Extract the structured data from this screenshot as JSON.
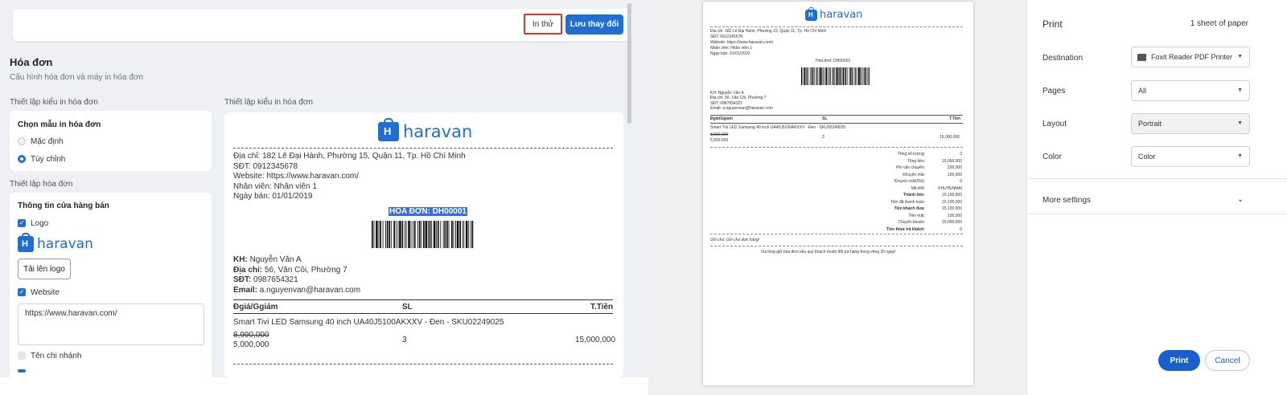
{
  "toolbar": {
    "test_print": "In thử",
    "save_changes": "Lưu thay đổi"
  },
  "page": {
    "title": "Hóa đơn",
    "subtitle": "Cấu hình hóa đơn và máy in hóa đơn"
  },
  "left_col": {
    "section_style": "Thiết lập kiểu in hóa đơn",
    "template_title": "Chọn mẫu in hóa đơn",
    "template_default": "Mặc định",
    "template_custom": "Tùy chỉnh",
    "section_invoice": "Thiết lập hóa đơn",
    "store_info_title": "Thông tin cửa hàng bán",
    "logo_label": "Logo",
    "upload_logo": "Tải lên logo",
    "website_label": "Website",
    "website_value": "https://www.haravan.com/",
    "branch_label": "Tên chi nhánh"
  },
  "preview_title": "Thiết lập kiểu in hóa đơn",
  "logo_text": "haravan",
  "invoice": {
    "address": "Địa chỉ: 182 Lê Đại Hành, Phường 15, Quận 11, Tp. Hồ Chí Minh",
    "phone": "SĐT: 0912345678",
    "website": "Website: https://www.haravan.com/",
    "staff": "Nhân viên: Nhân viên 1",
    "date": "Ngày bán: 01/01/2019",
    "invoice_no": "HÓA ĐƠN: DH00001",
    "customer_label": "KH:",
    "customer": "Nguyễn Văn A",
    "cust_addr_label": "Địa chỉ:",
    "cust_addr": "56, Văn Côi, Phường 7",
    "cust_phone_label": "SĐT:",
    "cust_phone": "0987654321",
    "cust_email_label": "Email:",
    "cust_email": "a.nguyenvan@haravan.com",
    "col_price": "Đgiá/Ggiảm",
    "col_qty": "SL",
    "col_total": "T.Tiền",
    "item_name": "Smart Tivi LED Samsung 40 inch UA40J5100AKXXV - Đen - SKU02249025",
    "item_old_price": "8,990,000",
    "item_price": "5,000,000",
    "item_qty": "3",
    "item_total": "15,000,000"
  },
  "print_preview": {
    "address": "Địa chỉ: 182 Lê Đại Hành, Phường 15, Quận 11, Tp. Hồ Chí Minh",
    "phone": "SĐT: 0912345678",
    "website": "Website: https://www.haravan.com/",
    "staff": "Nhân viên: Nhân viên 1",
    "date": "Ngày bán: 01/01/2019",
    "invoice_no": "Hóa đơn: DH00001",
    "customer": "KH: Nguyễn Văn A",
    "cust_addr": "Địa chỉ: 56, Văn Côi, Phường 7",
    "cust_phone": "SĐT: 0987654321",
    "cust_email": "Email: a.nguyenvan@haravan.com",
    "col_price": "Đgiá/Ggiảm",
    "col_qty": "SL",
    "col_total": "T.Tiền",
    "item_name": "Smart Tivi LED Samsung 40 inch UA40J5100AKXXV - Đen - SKU02249025",
    "item_old_price": "8,990,000",
    "item_price": "5,000,000",
    "item_qty": "3",
    "item_total": "15,000,000",
    "summary": [
      {
        "label": "Tổng số lượng:",
        "value": "3",
        "bold": false
      },
      {
        "label": "Tổng tiền:",
        "value": "15,000,000",
        "bold": false
      },
      {
        "label": "Phí vận chuyển:",
        "value": "200,000",
        "bold": false
      },
      {
        "label": "Khuyến mãi:",
        "value": "100,000",
        "bold": false
      },
      {
        "label": "Khuyến mãi(0%):",
        "value": "0",
        "bold": false
      },
      {
        "label": "Mã KM:",
        "value": "KHUYENMAI",
        "bold": false
      },
      {
        "label": "Thành tiền:",
        "value": "15,100,000",
        "bold": true
      },
      {
        "label": "Tiền đã thanh toán:",
        "value": "15,100,000",
        "bold": false
      },
      {
        "label": "Tiền khách đưa:",
        "value": "15,100,000",
        "bold": true
      },
      {
        "label": "Tiền mặt:",
        "value": "100,000",
        "bold": false
      },
      {
        "label": "Chuyển khoản:",
        "value": "15,000,000",
        "bold": false
      },
      {
        "label": "Tiền thừa trả khách:",
        "value": "0",
        "bold": true
      }
    ],
    "note": "Ghi chú: Ghi chú đơn hàng!",
    "footer": "Vui lòng giữ hóa đơn nếu quý khách muốn đổi trả hàng trong vòng 30 ngày!"
  },
  "print_dialog": {
    "title": "Print",
    "sheets": "1 sheet of paper",
    "destination_label": "Destination",
    "destination_value": "Foxit Reader PDF Printer",
    "pages_label": "Pages",
    "pages_value": "All",
    "layout_label": "Layout",
    "layout_value": "Portrait",
    "color_label": "Color",
    "color_value": "Color",
    "more_settings": "More settings",
    "print_button": "Print",
    "cancel_button": "Cancel"
  },
  "colors": {
    "accent": "#1f6ed4",
    "highlight_border": "#e0332c",
    "page_bg": "#eef0f4"
  }
}
